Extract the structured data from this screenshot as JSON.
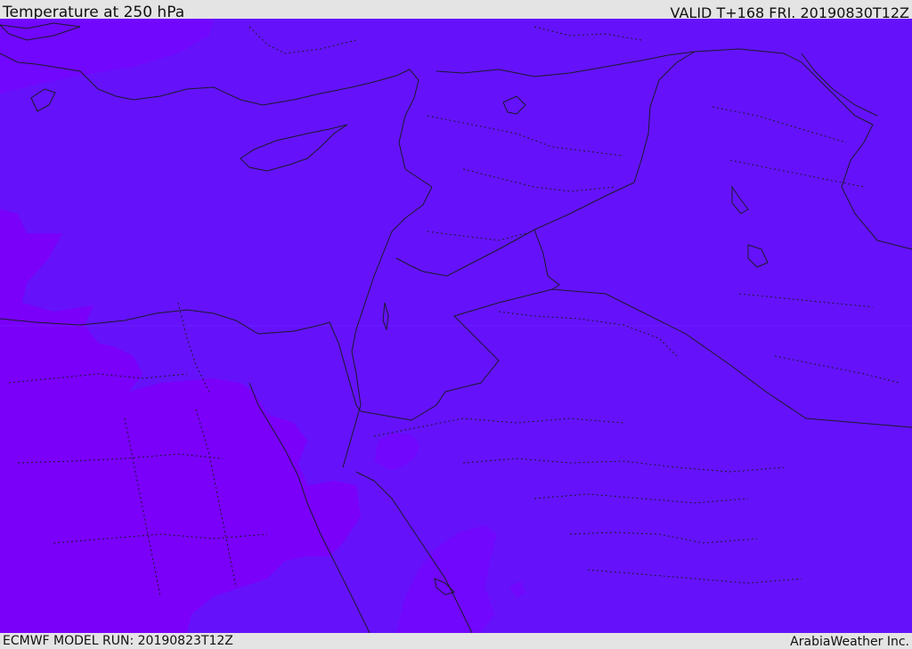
{
  "header": {
    "title": "Temperature at 250 hPa",
    "valid": "VALID T+168 FRI. 20190830T12Z"
  },
  "footer": {
    "model_run": "ECMWF MODEL RUN: 20190823T12Z",
    "credit": "ArabiaWeather Inc."
  },
  "colors": {
    "band_cold": "#7a00fa",
    "band_main": "#6512fb",
    "band_mid": "#7107fc",
    "coastline": "#1a1a2a",
    "header_bg": "#e4e4e4"
  },
  "map": {
    "region": "Eastern Mediterranean and Middle East",
    "field": "temperature at 250 hPa"
  }
}
